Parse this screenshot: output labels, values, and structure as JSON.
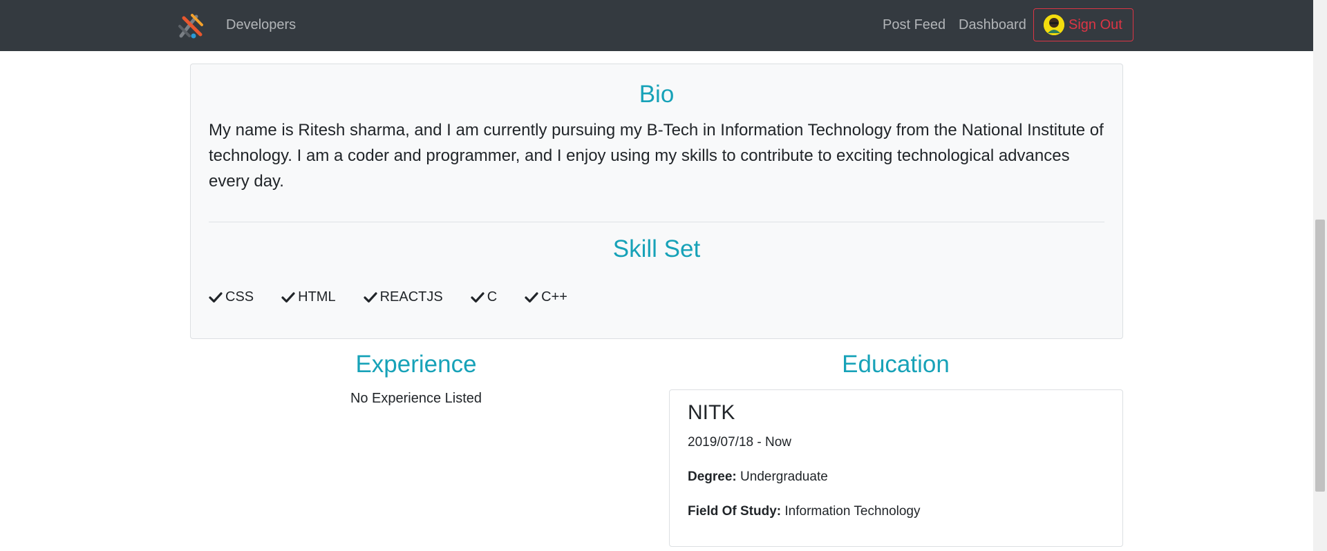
{
  "nav": {
    "brand": "Developers",
    "links": [
      "Post Feed",
      "Dashboard"
    ],
    "signout_label": "Sign Out",
    "colors": {
      "navbar": "#343a40",
      "danger": "#dc3545",
      "accent": "#17a2b8"
    }
  },
  "bio": {
    "heading": "Bio",
    "text": "My name is Ritesh sharma, and I am currently pursuing my B-Tech in Information Technology from the National Institute of technology. I am a coder and programmer, and I enjoy using my skills to contribute to exciting technological advances every day."
  },
  "skills": {
    "heading": "Skill Set",
    "items": [
      "CSS",
      "HTML",
      "REACTJS",
      "C",
      "C++"
    ]
  },
  "experience": {
    "heading": "Experience",
    "empty_text": "No Experience Listed"
  },
  "education": {
    "heading": "Education",
    "entries": [
      {
        "school": "NITK",
        "dates": "2019/07/18 - Now",
        "degree_label": "Degree:",
        "degree": "Undergraduate",
        "field_label": "Field Of Study:",
        "field": "Information Technology"
      }
    ]
  }
}
